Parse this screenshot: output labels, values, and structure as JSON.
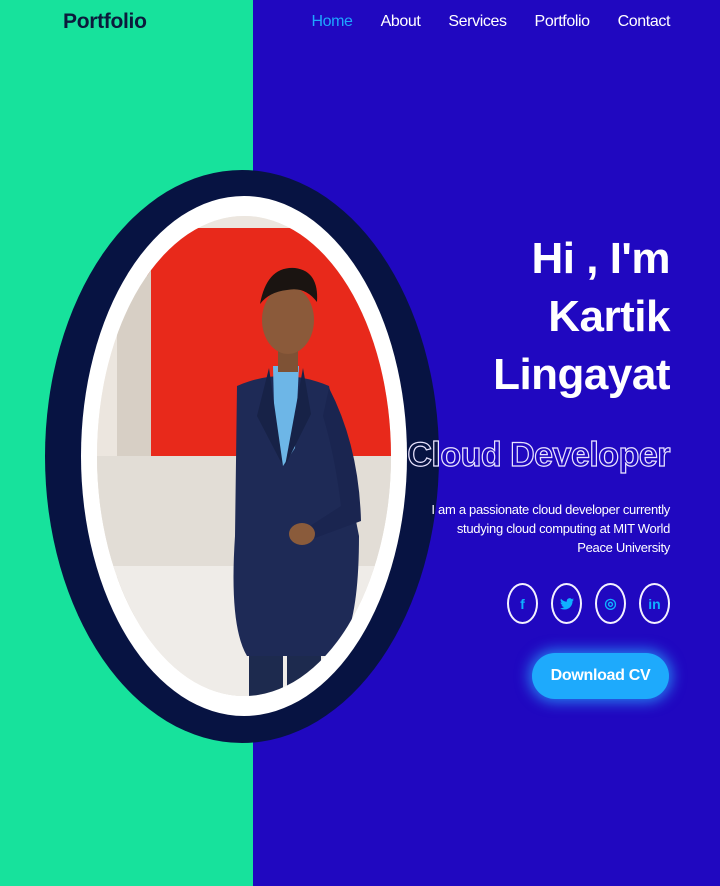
{
  "header": {
    "logo": "Portfolio",
    "nav": [
      {
        "label": "Home",
        "active": true
      },
      {
        "label": "About",
        "active": false
      },
      {
        "label": "Services",
        "active": false
      },
      {
        "label": "Portfolio",
        "active": false
      },
      {
        "label": "Contact",
        "active": false
      }
    ]
  },
  "hero": {
    "greeting_line1": "Hi , I'm",
    "greeting_line2": "Kartik",
    "greeting_line3": "Lingayat",
    "role": "Cloud Developer",
    "description": "I am a passionate cloud developer currently studying cloud computing at MIT World Peace University",
    "socials": [
      {
        "icon": "facebook-icon",
        "glyph": "f"
      },
      {
        "icon": "twitter-icon",
        "glyph": "t"
      },
      {
        "icon": "instagram-icon",
        "glyph": "◎"
      },
      {
        "icon": "linkedin-icon",
        "glyph": "in"
      }
    ],
    "cta": "Download CV"
  },
  "colors": {
    "left_bg": "#17e29c",
    "right_bg": "#2008c0",
    "accent": "#1eaafc",
    "circle_dark": "#071342"
  }
}
